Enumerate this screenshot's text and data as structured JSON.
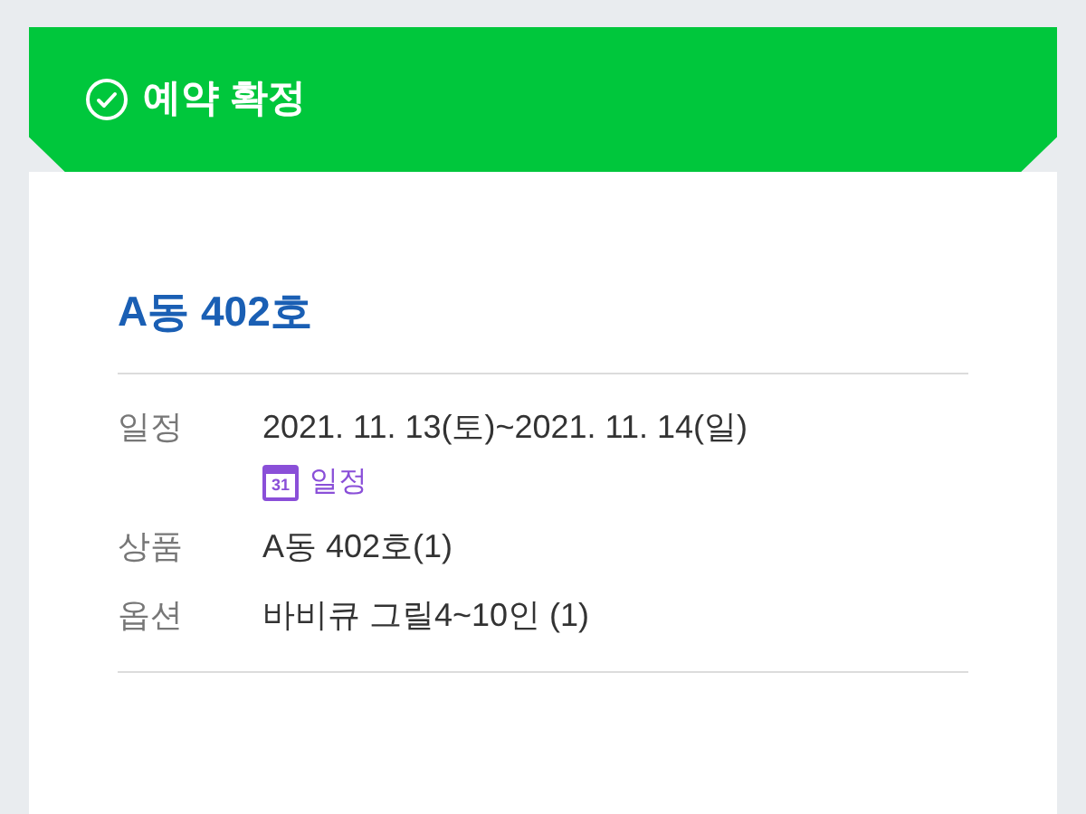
{
  "banner": {
    "title": "예약 확정"
  },
  "reservation": {
    "title": "A동 402호",
    "rows": [
      {
        "label": "일정",
        "value": "2021. 11. 13(토)~2021. 11. 14(일)",
        "link": {
          "icon_text": "31",
          "label": "일정"
        }
      },
      {
        "label": "상품",
        "value": "A동 402호(1)"
      },
      {
        "label": "옵션",
        "value": "바비큐 그릴4~10인 (1)"
      }
    ]
  }
}
